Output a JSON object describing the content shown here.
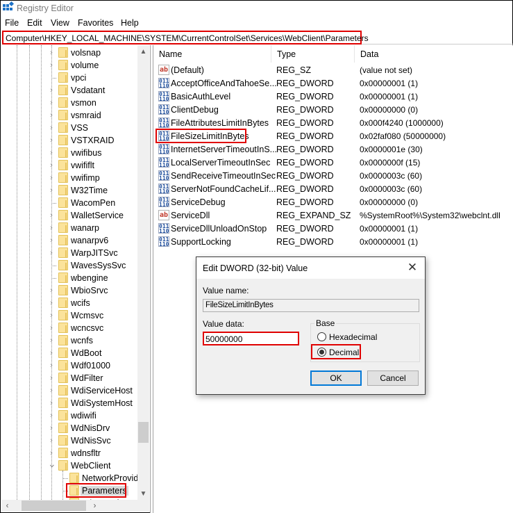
{
  "window": {
    "title": "Registry Editor",
    "icon": "registry-editor-icon"
  },
  "menu": [
    "File",
    "Edit",
    "View",
    "Favorites",
    "Help"
  ],
  "address": {
    "path": "Computer\\HKEY_LOCAL_MACHINE\\SYSTEM\\CurrentControlSet\\Services\\WebClient\\Parameters"
  },
  "tree": {
    "items": [
      {
        "label": "volsnap",
        "expandable": true
      },
      {
        "label": "volume",
        "expandable": true
      },
      {
        "label": "vpci",
        "expandable": false
      },
      {
        "label": "Vsdatant",
        "expandable": true
      },
      {
        "label": "vsmon",
        "expandable": true
      },
      {
        "label": "vsmraid",
        "expandable": true
      },
      {
        "label": "VSS",
        "expandable": true
      },
      {
        "label": "VSTXRAID",
        "expandable": true
      },
      {
        "label": "vwifibus",
        "expandable": true
      },
      {
        "label": "vwififlt",
        "expandable": true
      },
      {
        "label": "vwifimp",
        "expandable": true
      },
      {
        "label": "W32Time",
        "expandable": true
      },
      {
        "label": "WacomPen",
        "expandable": false
      },
      {
        "label": "WalletService",
        "expandable": true
      },
      {
        "label": "wanarp",
        "expandable": true
      },
      {
        "label": "wanarpv6",
        "expandable": true
      },
      {
        "label": "WarpJITSvc",
        "expandable": true
      },
      {
        "label": "WavesSysSvc",
        "expandable": false
      },
      {
        "label": "wbengine",
        "expandable": false
      },
      {
        "label": "WbioSrvc",
        "expandable": true
      },
      {
        "label": "wcifs",
        "expandable": true
      },
      {
        "label": "Wcmsvc",
        "expandable": true
      },
      {
        "label": "wcncsvc",
        "expandable": true
      },
      {
        "label": "wcnfs",
        "expandable": true
      },
      {
        "label": "WdBoot",
        "expandable": true
      },
      {
        "label": "Wdf01000",
        "expandable": true
      },
      {
        "label": "WdFilter",
        "expandable": true
      },
      {
        "label": "WdiServiceHost",
        "expandable": true
      },
      {
        "label": "WdiSystemHost",
        "expandable": true
      },
      {
        "label": "wdiwifi",
        "expandable": true
      },
      {
        "label": "WdNisDrv",
        "expandable": true
      },
      {
        "label": "WdNisSvc",
        "expandable": true
      },
      {
        "label": "wdnsfltr",
        "expandable": true
      },
      {
        "label": "WebClient",
        "expandable": true,
        "expanded": true
      }
    ],
    "children": [
      {
        "label": "NetworkProvid"
      },
      {
        "label": "Parameters",
        "selected": true
      },
      {
        "label": "TriggerInfo"
      }
    ]
  },
  "list": {
    "columns": [
      "Name",
      "Type",
      "Data"
    ],
    "rows": [
      {
        "name": "(Default)",
        "type": "REG_SZ",
        "data": "(value not set)",
        "icon": "string-value-icon"
      },
      {
        "name": "AcceptOfficeAndTahoeSe...",
        "type": "REG_DWORD",
        "data": "0x00000001 (1)",
        "icon": "binary-value-icon"
      },
      {
        "name": "BasicAuthLevel",
        "type": "REG_DWORD",
        "data": "0x00000001 (1)",
        "icon": "binary-value-icon"
      },
      {
        "name": "ClientDebug",
        "type": "REG_DWORD",
        "data": "0x00000000 (0)",
        "icon": "binary-value-icon"
      },
      {
        "name": "FileAttributesLimitInBytes",
        "type": "REG_DWORD",
        "data": "0x000f4240 (1000000)",
        "icon": "binary-value-icon"
      },
      {
        "name": "FileSizeLimitInBytes",
        "type": "REG_DWORD",
        "data": "0x02faf080 (50000000)",
        "icon": "binary-value-icon",
        "highlighted": true
      },
      {
        "name": "InternetServerTimeoutInS...",
        "type": "REG_DWORD",
        "data": "0x0000001e (30)",
        "icon": "binary-value-icon"
      },
      {
        "name": "LocalServerTimeoutInSec",
        "type": "REG_DWORD",
        "data": "0x0000000f (15)",
        "icon": "binary-value-icon"
      },
      {
        "name": "SendReceiveTimeoutInSec",
        "type": "REG_DWORD",
        "data": "0x0000003c (60)",
        "icon": "binary-value-icon"
      },
      {
        "name": "ServerNotFoundCacheLif...",
        "type": "REG_DWORD",
        "data": "0x0000003c (60)",
        "icon": "binary-value-icon"
      },
      {
        "name": "ServiceDebug",
        "type": "REG_DWORD",
        "data": "0x00000000 (0)",
        "icon": "binary-value-icon"
      },
      {
        "name": "ServiceDll",
        "type": "REG_EXPAND_SZ",
        "data": "%SystemRoot%\\System32\\webclnt.dll",
        "icon": "string-value-icon"
      },
      {
        "name": "ServiceDllUnloadOnStop",
        "type": "REG_DWORD",
        "data": "0x00000001 (1)",
        "icon": "binary-value-icon"
      },
      {
        "name": "SupportLocking",
        "type": "REG_DWORD",
        "data": "0x00000001 (1)",
        "icon": "binary-value-icon"
      }
    ]
  },
  "dialog": {
    "title": "Edit DWORD (32-bit) Value",
    "value_name_label": "Value name:",
    "value_name": "FileSizeLimitInBytes",
    "value_data_label": "Value data:",
    "value_data": "50000000",
    "base_label": "Base",
    "base_options": [
      {
        "label": "Hexadecimal",
        "checked": false
      },
      {
        "label": "Decimal",
        "checked": true
      }
    ],
    "ok_label": "OK",
    "cancel_label": "Cancel",
    "close_glyph": "✕"
  },
  "colors": {
    "highlight": "#e00000",
    "default_button_border": "#0078d7",
    "folder": "#fbe39b"
  }
}
